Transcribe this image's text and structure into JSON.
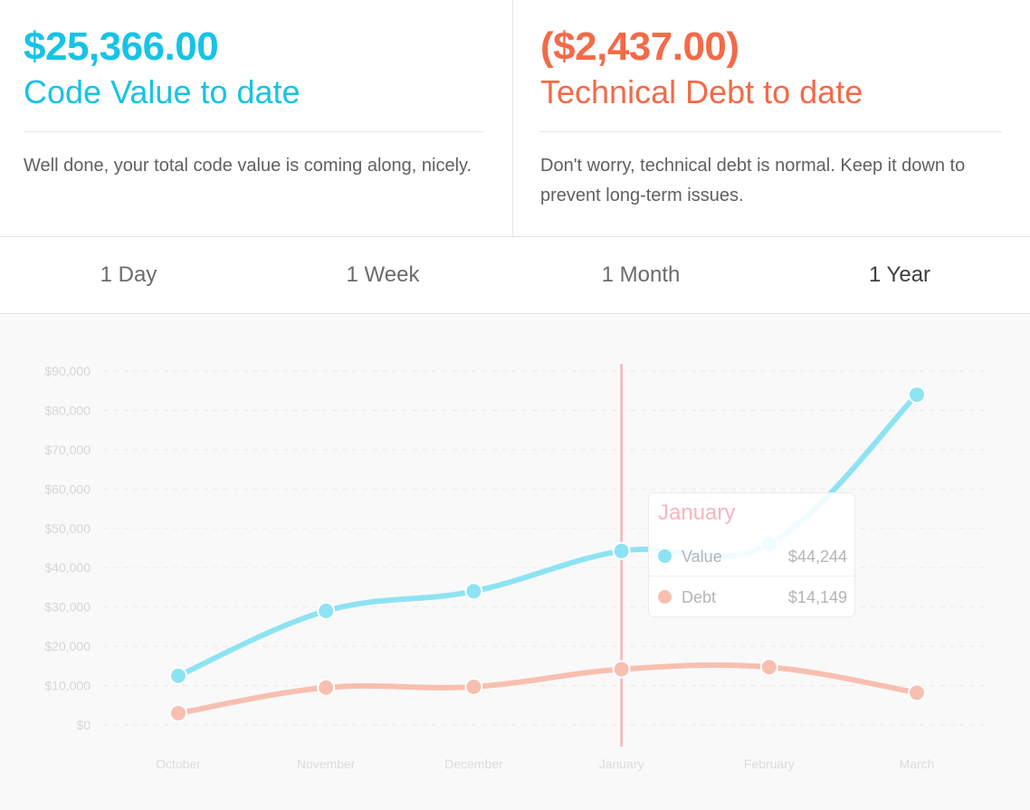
{
  "summary": {
    "value": {
      "amount": "$25,366.00",
      "caption": "Code Value to date",
      "description": "Well done, your total code value is coming along, nicely.",
      "color": "#17c3e6"
    },
    "debt": {
      "amount": "($2,437.00)",
      "caption": "Technical Debt to date",
      "description": "Don't worry, technical debt is normal. Keep it down to prevent long-term issues.",
      "color": "#f36a48"
    }
  },
  "tabs": [
    {
      "label": "1 Day",
      "active": false
    },
    {
      "label": "1 Week",
      "active": false
    },
    {
      "label": "1 Month",
      "active": false
    },
    {
      "label": "1 Year",
      "active": true
    }
  ],
  "tooltip": {
    "title": "January",
    "rows": [
      {
        "label": "Value",
        "value": "$44,244",
        "color": "#8de3f3"
      },
      {
        "label": "Debt",
        "value": "$14,149",
        "color": "#f8bfb0"
      }
    ]
  },
  "chart_data": {
    "type": "line",
    "categories": [
      "October",
      "November",
      "December",
      "January",
      "February",
      "March"
    ],
    "series": [
      {
        "name": "Value",
        "values": [
          12500,
          29000,
          34000,
          44244,
          46000,
          84000
        ],
        "color": "#8de3f3"
      },
      {
        "name": "Debt",
        "values": [
          3000,
          9500,
          9700,
          14149,
          14700,
          8200
        ],
        "color": "#f8bfb0"
      }
    ],
    "yticks": [
      "$0",
      "$10,000",
      "$20,000",
      "$30,000",
      "$40,000",
      "$50,000",
      "$60,000",
      "$70,000",
      "$80,000",
      "$90,000"
    ],
    "ylim": [
      0,
      90000
    ],
    "highlight_category": "January",
    "highlight_color": "#f7b4bd",
    "grid": true
  }
}
